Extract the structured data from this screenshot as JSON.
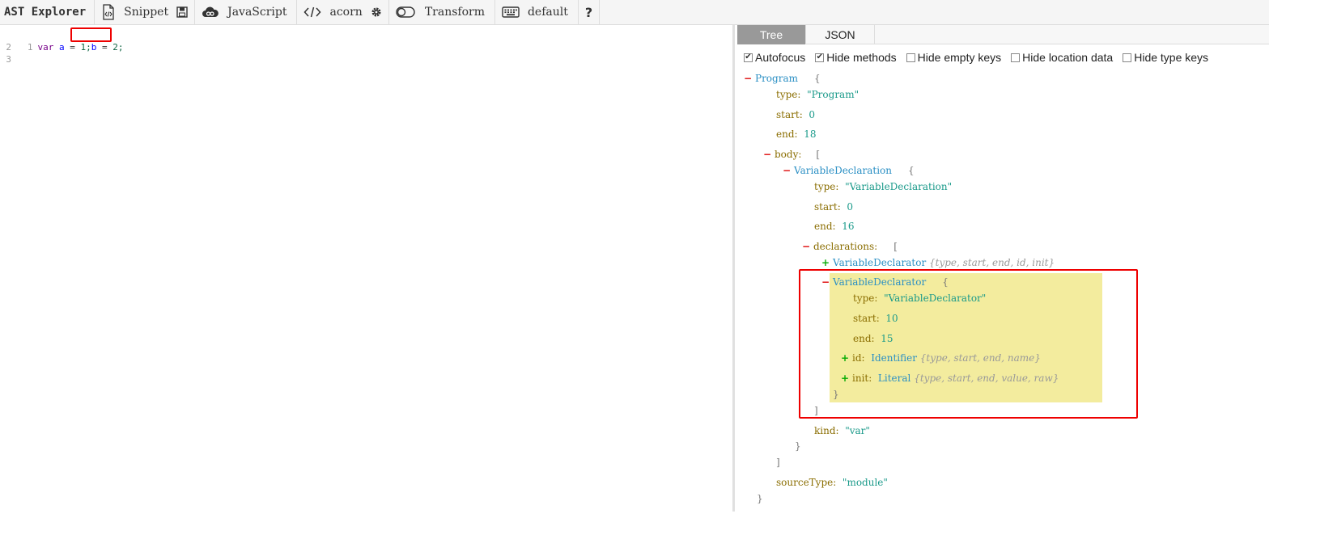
{
  "toolbar": {
    "title": "AST Explorer",
    "snippet": "Snippet",
    "language": "JavaScript",
    "parser": "acorn",
    "transform": "Transform",
    "keymap": "default"
  },
  "editor": {
    "lines": [
      {
        "num": "1",
        "tokens": [
          "var",
          "a",
          "=",
          "1;",
          "b",
          "=",
          "2;"
        ]
      },
      {
        "num": "2"
      },
      {
        "num": "3"
      }
    ]
  },
  "tabs": [
    "Tree",
    "JSON"
  ],
  "options": [
    "Autofocus",
    "Hide methods",
    "Hide empty keys",
    "Hide location data",
    "Hide type keys"
  ],
  "options_checked": [
    true,
    true,
    false,
    false,
    false
  ],
  "tree": {
    "program": "Program",
    "k_type": "type:",
    "k_start": "start:",
    "k_end": "end:",
    "k_body": "body:",
    "k_declarations": "declarations:",
    "k_id": "id:",
    "k_init": "init:",
    "k_kind": "kind:",
    "k_sourceType": "sourceType:",
    "program_type": "\"Program\"",
    "program_start": "0",
    "program_end": "18",
    "vardecl": "VariableDeclaration",
    "vardecl_type": "\"VariableDeclaration\"",
    "vardecl_start": "0",
    "vardecl_end": "16",
    "declarator": "VariableDeclarator",
    "declarator_summary": "{type, start, end, id, init}",
    "declarator_type": "\"VariableDeclarator\"",
    "declarator_start": "10",
    "declarator_end": "15",
    "identifier": "Identifier",
    "identifier_summary": "{type, start, end, name}",
    "literal": "Literal",
    "literal_summary": "{type, start, end, value, raw}",
    "kind_value": "\"var\"",
    "sourceType_value": "\"module\""
  }
}
